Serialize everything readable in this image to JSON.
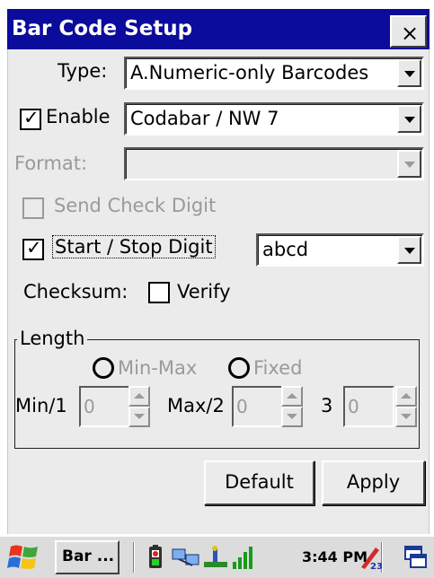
{
  "window": {
    "title": "Bar Code Setup",
    "close_glyph": "×"
  },
  "type_row": {
    "label": "Type:",
    "value": "A.Numeric-only Barcodes"
  },
  "enable_row": {
    "checkbox_label": "Enable",
    "checked": true,
    "value": "Codabar / NW 7"
  },
  "format_row": {
    "label": "Format:",
    "value": ""
  },
  "send_check_digit": {
    "label": "Send Check Digit",
    "checked": false,
    "enabled": false
  },
  "start_stop": {
    "label": "Start / Stop Digit",
    "checked": true,
    "value": "abcd"
  },
  "checksum": {
    "label": "Checksum:",
    "verify_label": "Verify",
    "checked": false
  },
  "length": {
    "title": "Length",
    "radio_minmax": "Min-Max",
    "radio_fixed": "Fixed",
    "min_label": "Min/1",
    "min_value": "0",
    "max_label": "Max/2",
    "max_value": "0",
    "third_label": "3",
    "third_value": "0"
  },
  "buttons": {
    "default": "Default",
    "apply": "Apply"
  },
  "taskbar": {
    "task_label": "Bar ...",
    "clock": "3:44 PM",
    "icons": [
      "windows-start-icon",
      "battery-icon",
      "network-icon",
      "usb-icon",
      "signal-icon",
      "input-panel-icon",
      "switch-window-icon"
    ]
  },
  "colors": {
    "titlebar": "#0b0b9c",
    "dialog_bg": "#ebebeb",
    "disabled_text": "#9a9a9a"
  }
}
